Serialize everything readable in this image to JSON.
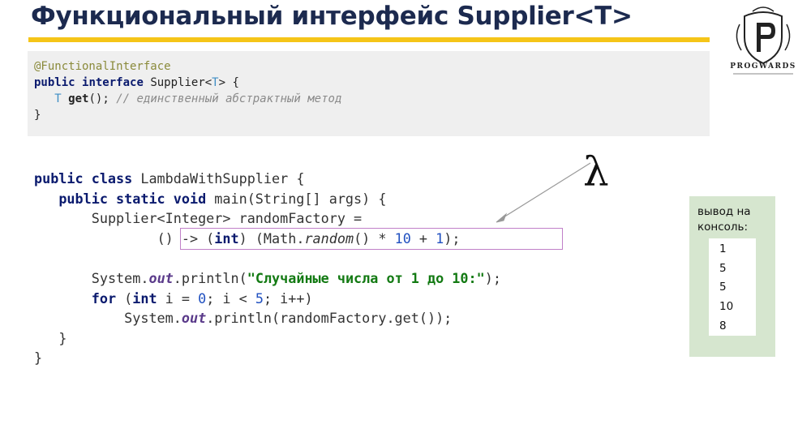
{
  "title": "Функциональный интерфейс Supplier<T>",
  "logo": {
    "text": "PROGWARDS",
    "icon": "progwards-crest-icon"
  },
  "declaration": {
    "annotation": "@FunctionalInterface",
    "kw_public": "public",
    "kw_interface": "interface",
    "type_name": "Supplier<",
    "type_param": "T",
    "open": "> {",
    "method_type": "T",
    "method_name": "get",
    "method_rest": "();",
    "comment": "// единственный абстрактный метод",
    "close": "}"
  },
  "code": {
    "l1_kw": "public class",
    "l1_rest": " LambdaWithSupplier {",
    "l2_kw": "public static void",
    "l2_rest": " main(String[] args) {",
    "l3": "Supplier<Integer> randomFactory =",
    "l4_a": "() -> (",
    "l4_kw": "int",
    "l4_b": ") (Math.",
    "l4_method": "random",
    "l4_c": "() * ",
    "l4_n1": "10",
    "l4_d": " + ",
    "l4_n2": "1",
    "l4_e": ");",
    "l5_a": "System.",
    "l5_out": "out",
    "l5_b": ".println(",
    "l5_str": "\"Случайные числа от 1 до 10:\"",
    "l5_c": ");",
    "l6_kw": "for",
    "l6_a": " (",
    "l6_kw2": "int",
    "l6_b": " i = ",
    "l6_n0": "0",
    "l6_c": "; i < ",
    "l6_n5": "5",
    "l6_d": "; i++)",
    "l7_a": "System.",
    "l7_out": "out",
    "l7_b": ".println(randomFactory.get());",
    "l8": "}",
    "l9": "}"
  },
  "lambda_symbol": "λ",
  "console": {
    "title": "вывод на консоль:",
    "values": [
      "1",
      "5",
      "5",
      "10",
      "8"
    ]
  }
}
